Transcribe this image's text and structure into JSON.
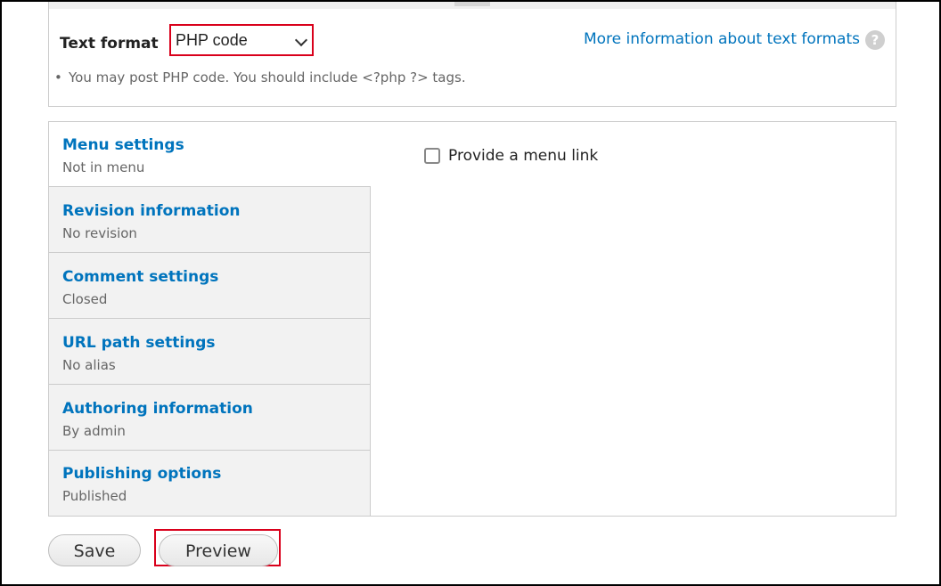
{
  "text_format": {
    "label": "Text format",
    "selected": "PHP code",
    "more_info_link": "More information about text formats",
    "help_icon": "?",
    "tip": "You may post PHP code. You should include <?php ?> tags."
  },
  "vertical_tabs": [
    {
      "title": "Menu settings",
      "summary": "Not in menu",
      "active": true
    },
    {
      "title": "Revision information",
      "summary": "No revision",
      "active": false
    },
    {
      "title": "Comment settings",
      "summary": "Closed",
      "active": false
    },
    {
      "title": "URL path settings",
      "summary": "No alias",
      "active": false
    },
    {
      "title": "Authoring information",
      "summary": "By admin",
      "active": false
    },
    {
      "title": "Publishing options",
      "summary": "Published",
      "active": false
    }
  ],
  "menu_settings": {
    "checkbox_label": "Provide a menu link",
    "checked": false
  },
  "actions": {
    "save_label": "Save",
    "preview_label": "Preview"
  },
  "colors": {
    "link": "#0074bd",
    "highlight": "#d9001b"
  }
}
